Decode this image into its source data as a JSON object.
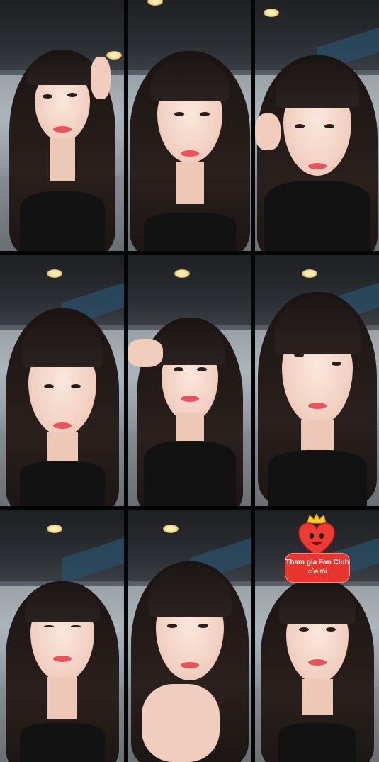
{
  "grid": {
    "columns": 3,
    "rows": 3,
    "tile_count": 9
  },
  "fan_club_badge": {
    "line1": "Tham gia Fan Club",
    "line2": "của tôi",
    "color": "#e8352e"
  },
  "colors": {
    "divider": "#050505",
    "lip_color": "#e8545c",
    "hair_color": "#1a1412"
  }
}
